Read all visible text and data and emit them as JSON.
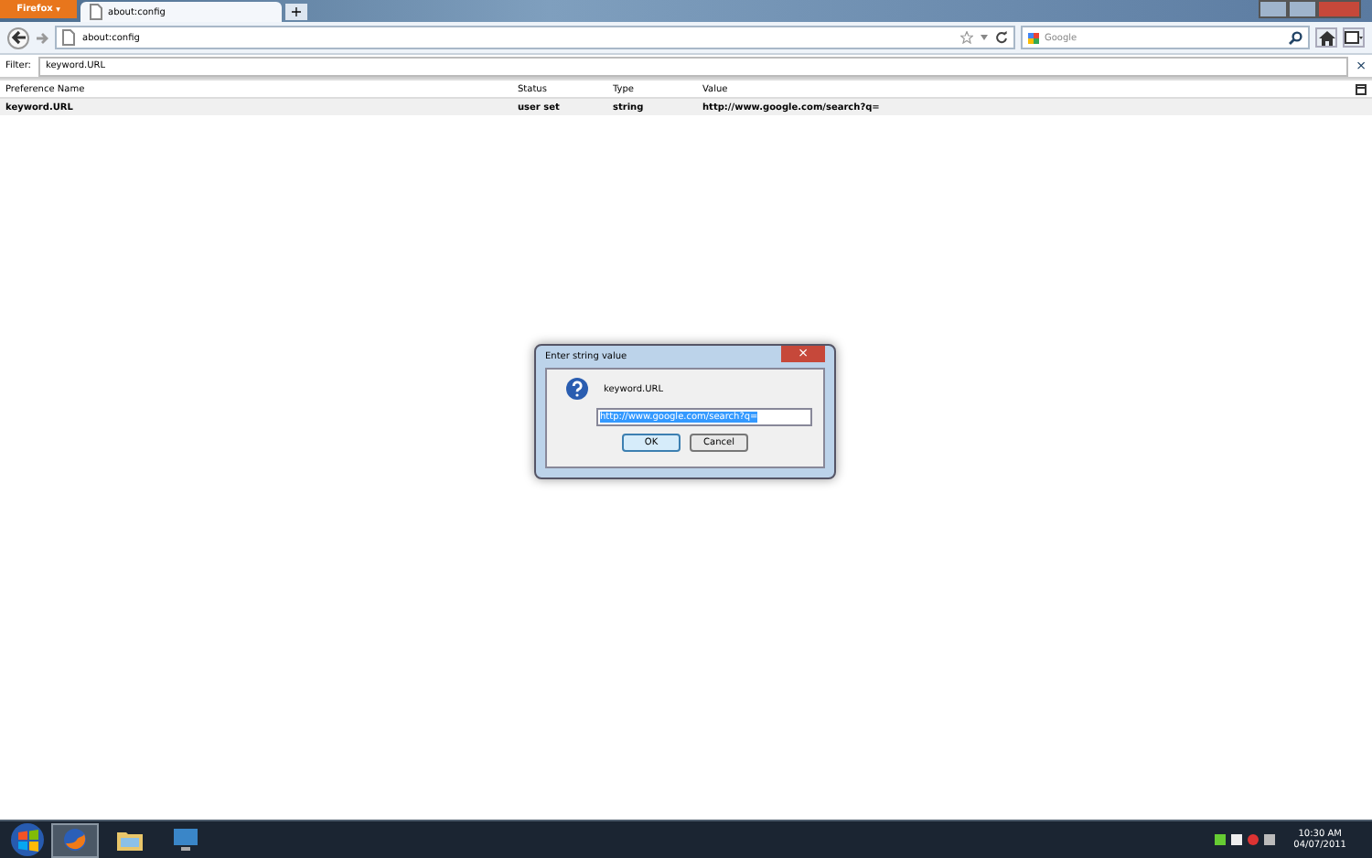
{
  "app_button": {
    "label": "Firefox",
    "caret": "▼"
  },
  "tabs": [
    {
      "label": "about:config",
      "selected": true
    }
  ],
  "new_tab": "+",
  "address": {
    "value": "about:config"
  },
  "search": {
    "placeholder": "Google"
  },
  "filter": {
    "label": "Filter:",
    "value": "keyword.URL",
    "clear": "×"
  },
  "table": {
    "columns": [
      "Preference Name",
      "Status",
      "Type",
      "Value"
    ],
    "rows": [
      {
        "cells": [
          "keyword.URL",
          "user set",
          "string",
          "http://www.google.com/search?q="
        ],
        "selected": true
      }
    ]
  },
  "dialog": {
    "title": "Enter string value",
    "close": "×",
    "message": "keyword.URL",
    "value": "http://www.google.com/search?q=",
    "buttons": [
      {
        "label": "OK",
        "default": true
      },
      {
        "label": "Cancel",
        "default": false
      }
    ]
  },
  "taskbar": {
    "apps": [
      {
        "kind": "browser",
        "active": true
      },
      {
        "kind": "folder",
        "active": false
      },
      {
        "kind": "monitor",
        "active": false
      }
    ],
    "time": "10:30 AM",
    "date": "04/07/2011"
  }
}
